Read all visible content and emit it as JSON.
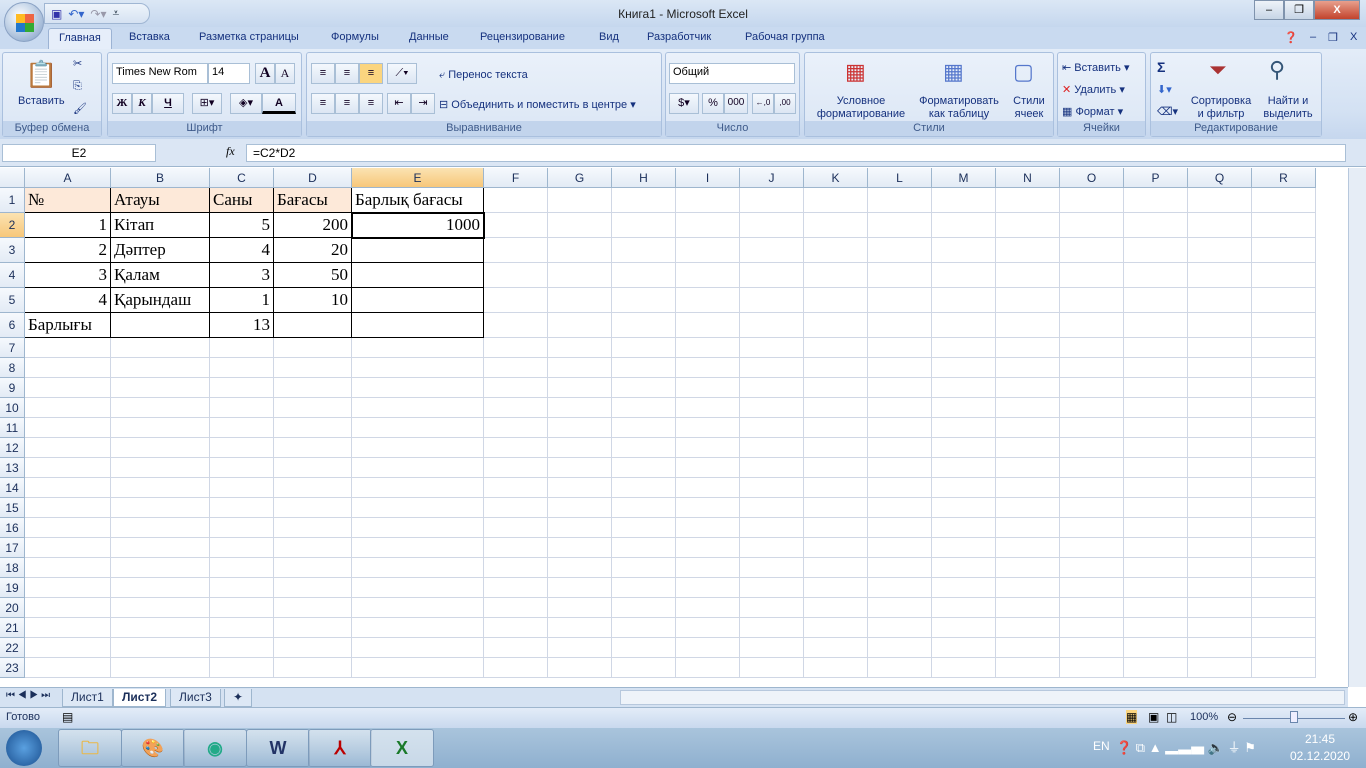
{
  "window": {
    "title": "Книга1 - Microsoft Excel",
    "minimize": "–",
    "restore": "❐",
    "close": "X"
  },
  "ribbon_tabs": [
    "Главная",
    "Вставка",
    "Разметка страницы",
    "Формулы",
    "Данные",
    "Рецензирование",
    "Вид",
    "Разработчик",
    "Рабочая группа"
  ],
  "clipboard": {
    "paste": "Вставить",
    "label": "Буфер обмена"
  },
  "font": {
    "name": "Times New Rom",
    "size": "14",
    "bold": "Ж",
    "italic": "К",
    "underline": "Ч",
    "grow": "A",
    "shrink": "A",
    "color": "A",
    "label": "Шрифт"
  },
  "alignment": {
    "wrap": "Перенос текста",
    "merge": "Объединить и поместить в центре",
    "label": "Выравнивание"
  },
  "number": {
    "format": "Общий",
    "percent": "%",
    "thousands": "000",
    "inc": "←,0",
    "dec": ",00",
    "label": "Число"
  },
  "styles": {
    "conditional": "Условное форматирование",
    "as_table": "Форматировать как таблицу",
    "cell_styles": "Стили ячеек",
    "label": "Стили"
  },
  "cells": {
    "insert": "Вставить",
    "delete": "Удалить",
    "format": "Формат",
    "label": "Ячейки"
  },
  "editing": {
    "sum": "Σ",
    "sort": "Сортировка и фильтр",
    "find": "Найти и выделить",
    "label": "Редактирование"
  },
  "formula_bar": {
    "name_box": "E2",
    "fx": "fx",
    "formula": "=C2*D2"
  },
  "columns": [
    "A",
    "B",
    "C",
    "D",
    "E",
    "F",
    "G",
    "H",
    "I",
    "J",
    "K",
    "L",
    "M",
    "N",
    "O",
    "P",
    "Q",
    "R"
  ],
  "selected": {
    "col": "E",
    "row": 2
  },
  "rows": [
    [
      "№",
      "Атауы",
      "Саны",
      "Бағасы",
      "Барлық бағасы"
    ],
    [
      "1",
      "Кітап",
      "5",
      "200",
      "1000"
    ],
    [
      "2",
      "Дәптер",
      "4",
      "20",
      ""
    ],
    [
      "3",
      "Қалам",
      "3",
      "50",
      ""
    ],
    [
      "4",
      "Қарындаш",
      "1",
      "10",
      ""
    ],
    [
      "Барлығы",
      "",
      "13",
      "",
      ""
    ]
  ],
  "row_count": 23,
  "sheets": [
    "Лист1",
    "Лист2",
    "Лист3"
  ],
  "active_sheet": "Лист2",
  "status": {
    "ready": "Готово",
    "zoom": "100%"
  },
  "taskbar": {
    "lang": "EN",
    "time": "21:45",
    "date": "02.12.2020",
    "apps": [
      "explorer",
      "paint",
      "chrome",
      "word",
      "acrobat",
      "excel"
    ]
  }
}
